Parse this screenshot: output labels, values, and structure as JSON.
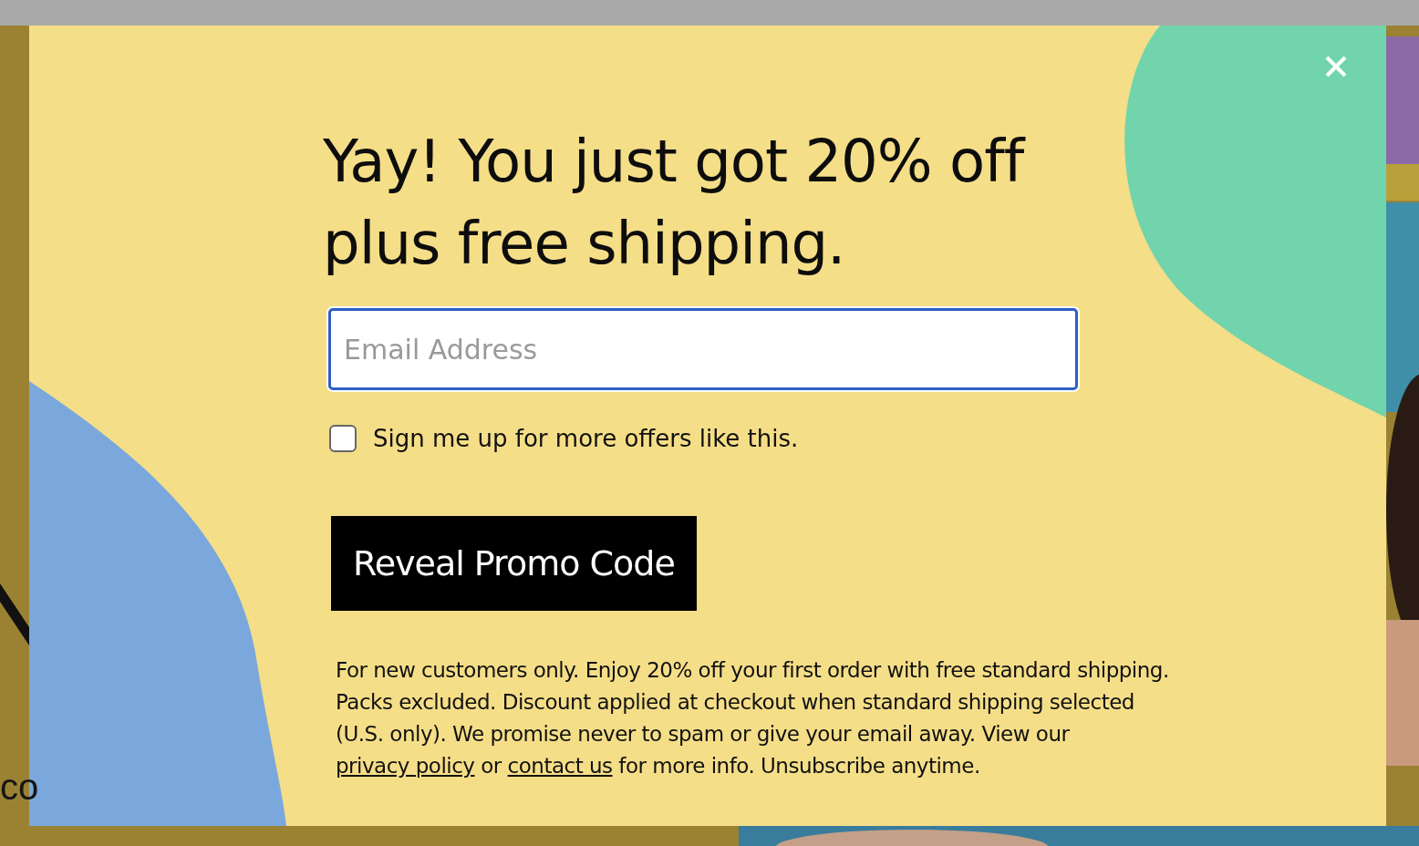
{
  "background": {
    "fragment": "co"
  },
  "modal": {
    "heading": "Yay! You just got 20% off plus free shipping.",
    "email": {
      "placeholder": "Email Address",
      "focused": true
    },
    "signup": {
      "label": "Sign me up for more offers like this.",
      "checked": false
    },
    "button": "Reveal Promo Code",
    "fine_print": [
      {
        "kind": "text",
        "text": "For new customers only. Enjoy 20% off your first order with free standard shipping. Packs excluded. Discount applied at checkout when standard shipping selected (U.S. only). We promise never to spam or give your email away. View our "
      },
      {
        "kind": "link",
        "text": "privacy policy"
      },
      {
        "kind": "text",
        "text": " or "
      },
      {
        "kind": "link",
        "text": "contact us"
      },
      {
        "kind": "text",
        "text": " for more info. Unsubscribe anytime."
      }
    ]
  }
}
